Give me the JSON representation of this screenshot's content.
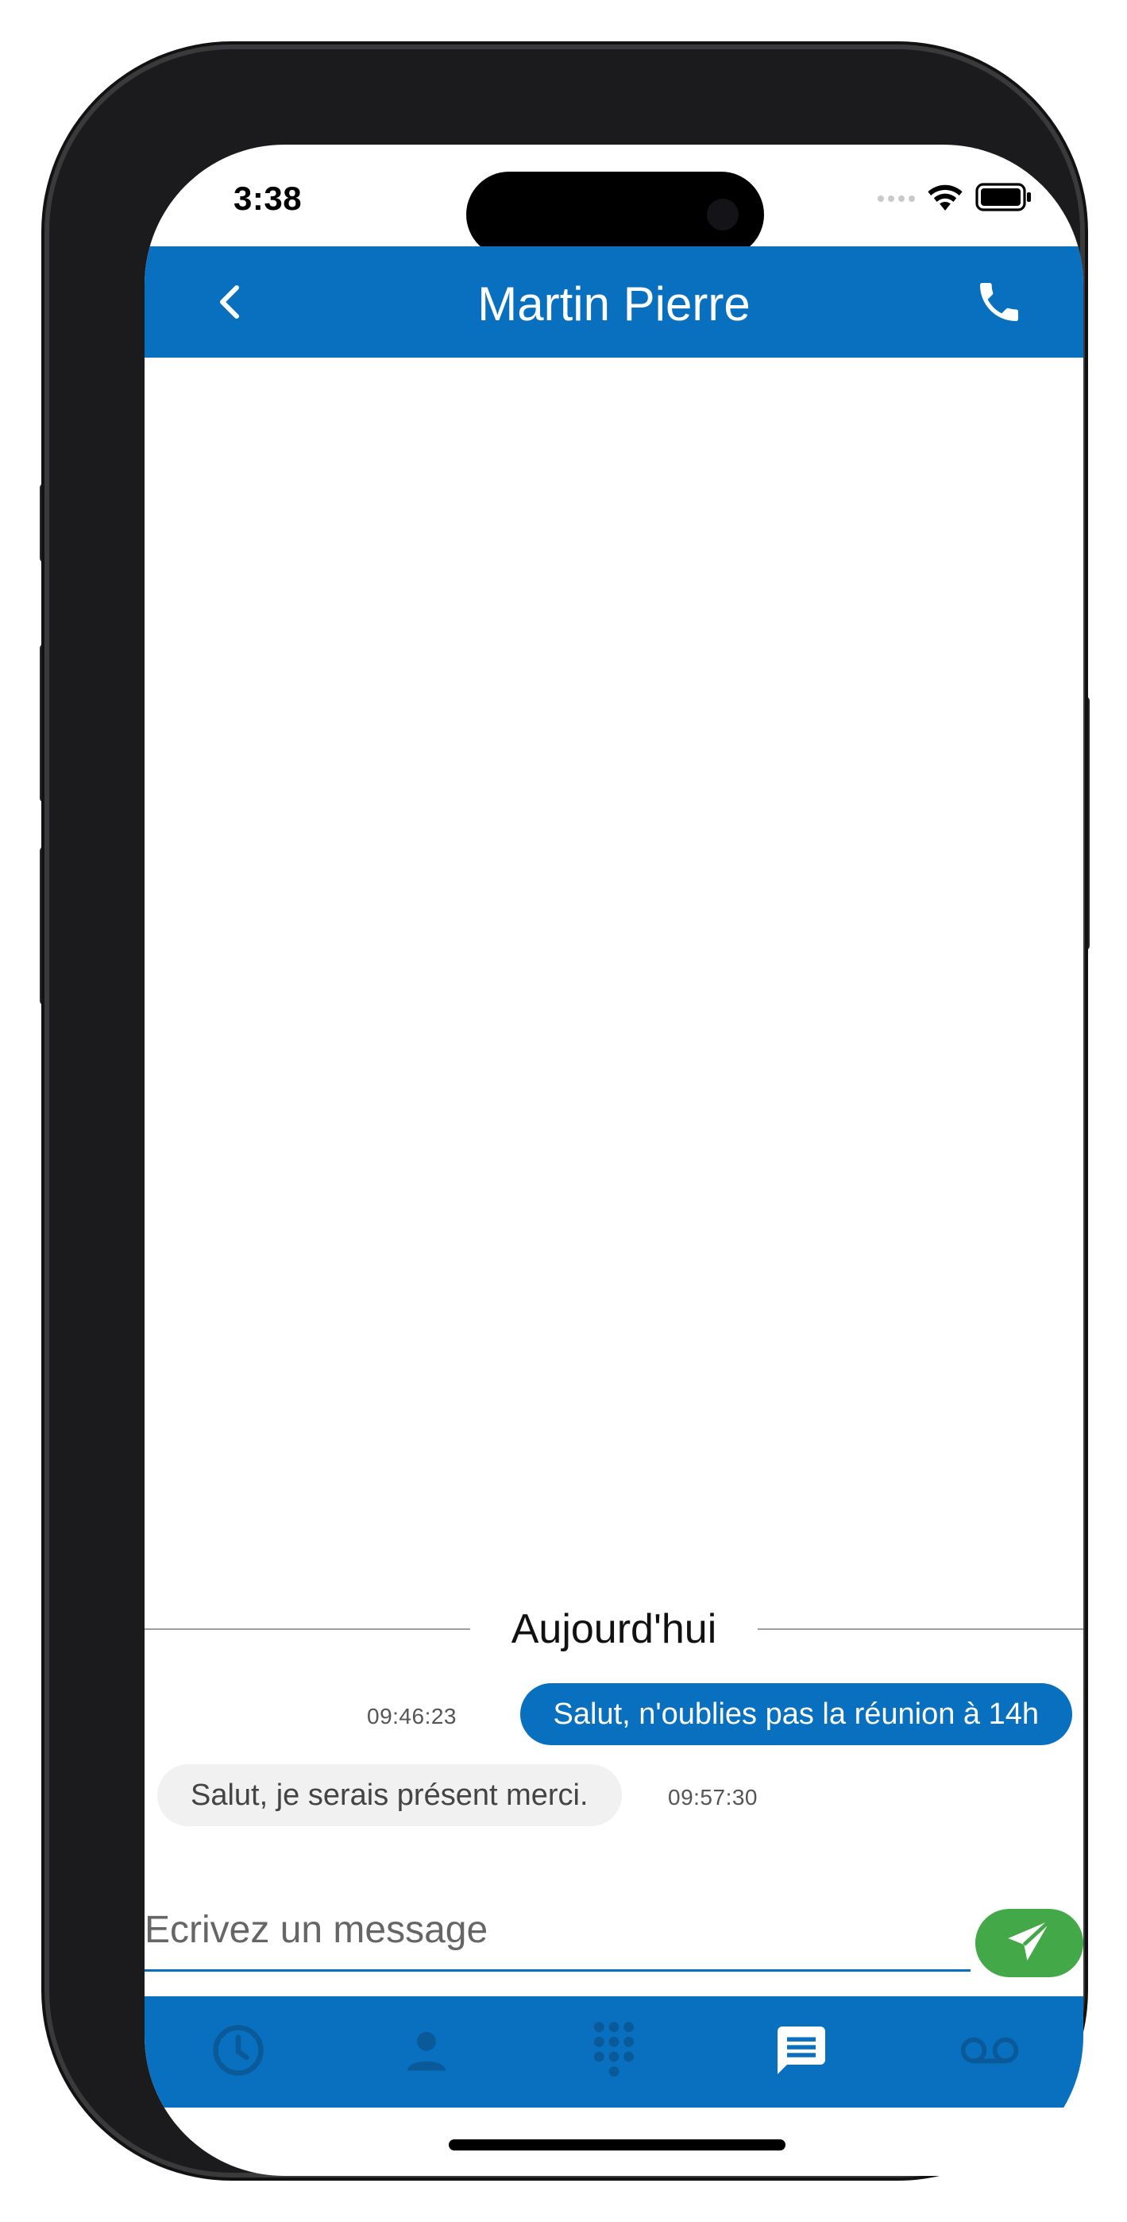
{
  "status_bar": {
    "time": "3:38"
  },
  "header": {
    "title": "Martin Pierre"
  },
  "conversation": {
    "date_separator": "Aujourd'hui",
    "messages": [
      {
        "direction": "outgoing",
        "text": "Salut, n'oublies pas la réunion à 14h",
        "time": "09:46:23"
      },
      {
        "direction": "incoming",
        "text": "Salut, je serais présent merci.",
        "time": "09:57:30"
      }
    ]
  },
  "composer": {
    "placeholder": "Ecrivez un message",
    "value": ""
  },
  "bottom_nav": {
    "tabs": [
      {
        "icon": "history-clock-icon",
        "active": false
      },
      {
        "icon": "contact-person-icon",
        "active": false
      },
      {
        "icon": "dialpad-icon",
        "active": false
      },
      {
        "icon": "chat-message-icon",
        "active": true
      },
      {
        "icon": "voicemail-icon",
        "active": false
      }
    ]
  },
  "colors": {
    "primary": "#0870bf",
    "send_button": "#43a847",
    "inactive_icon": "#0a5a99",
    "incoming_bubble": "#f1f1f1"
  }
}
